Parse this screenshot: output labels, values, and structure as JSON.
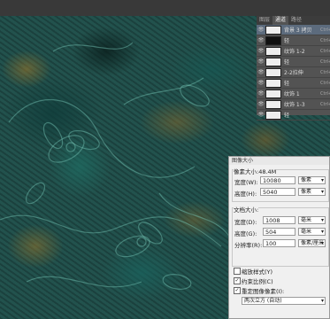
{
  "layers_panel": {
    "tabs": [
      "图层",
      "通道",
      "路径"
    ],
    "active_tab": 1,
    "rows": [
      {
        "name": "背景 3 拷贝",
        "shortcut": "Ctrl+",
        "thumb": "light",
        "selected": true
      },
      {
        "name": "轻",
        "shortcut": "Ctrl+",
        "thumb": "dark",
        "selected": false
      },
      {
        "name": "纹饰 1-2",
        "shortcut": "Ctrl+",
        "thumb": "light",
        "selected": false
      },
      {
        "name": "轻",
        "shortcut": "Ctrl+",
        "thumb": "light",
        "selected": false
      },
      {
        "name": "2-2拉伸",
        "shortcut": "Ctrl+",
        "thumb": "light",
        "selected": false
      },
      {
        "name": "轻",
        "shortcut": "Ctrl+",
        "thumb": "light",
        "selected": false
      },
      {
        "name": "纹饰 1",
        "shortcut": "Ctrl+",
        "thumb": "light",
        "selected": false
      },
      {
        "name": "纹饰 1-3",
        "shortcut": "Ctrl+",
        "thumb": "light",
        "selected": false
      },
      {
        "name": "轻",
        "shortcut": "",
        "thumb": "light",
        "selected": false
      }
    ]
  },
  "dialog": {
    "title": "图像大小",
    "pixel_size_label": "像素大小:48.4M",
    "width_label": "宽度(W):",
    "width_value": "10080",
    "width_unit": "像素",
    "height_label": "高度(H):",
    "height_value": "5040",
    "height_unit": "像素",
    "doc_size_label": "文档大小:",
    "doc_width_label": "宽度(D):",
    "doc_width_value": "1008",
    "doc_width_unit": "毫米",
    "doc_height_label": "高度(G):",
    "doc_height_value": "504",
    "doc_height_unit": "毫米",
    "resolution_label": "分辨率(R):",
    "resolution_value": "100",
    "resolution_unit": "像素/厘米",
    "scale_styles_label": "缩放样式(Y)",
    "scale_styles_checked": false,
    "constrain_label": "约束比例(C)",
    "constrain_checked": true,
    "resample_label": "重定图像像素(I):",
    "resample_checked": true,
    "resample_method": "两次立方 (自动)"
  }
}
